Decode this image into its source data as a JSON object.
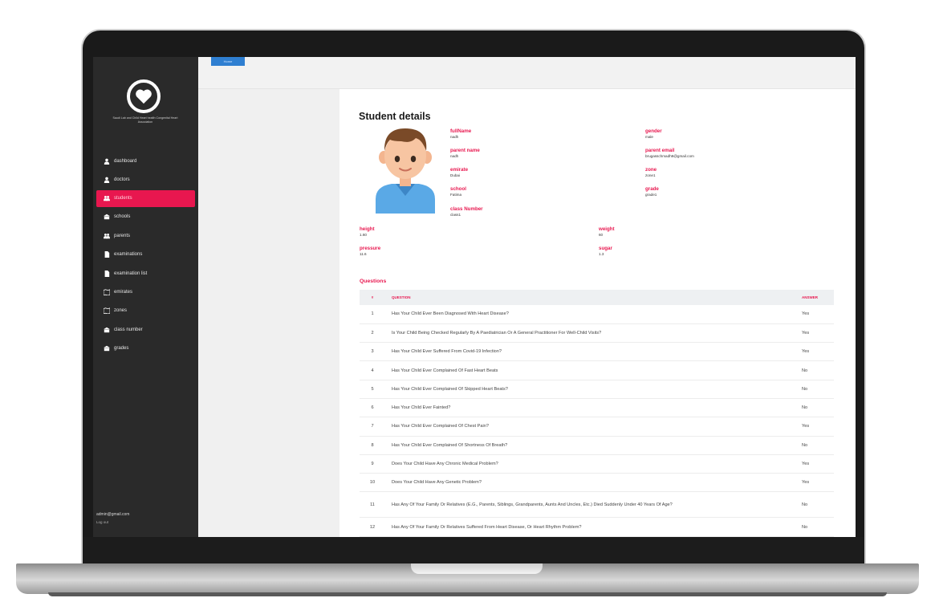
{
  "logo": {
    "icon": "heart-icon",
    "subtitle": "Saudi Lab and Child Heart health Congenital Heart Association"
  },
  "sidebar": {
    "items": [
      {
        "label": "dashboard",
        "icon": "user-icon"
      },
      {
        "label": "doctors",
        "icon": "user-icon"
      },
      {
        "label": "students",
        "icon": "users-icon"
      },
      {
        "label": "schools",
        "icon": "school-icon"
      },
      {
        "label": "parents",
        "icon": "users-icon"
      },
      {
        "label": "examinations",
        "icon": "file-icon"
      },
      {
        "label": "examination list",
        "icon": "file-icon"
      },
      {
        "label": "emirates",
        "icon": "map-icon"
      },
      {
        "label": "zones",
        "icon": "map-icon"
      },
      {
        "label": "class number",
        "icon": "school-icon"
      },
      {
        "label": "grades",
        "icon": "school-icon"
      }
    ],
    "active_index": 2,
    "user_email": "admin@gmail.com",
    "logout_label": "Log out"
  },
  "topbar": {
    "tab_label": "Home"
  },
  "student": {
    "title": "Student details",
    "fullname": {
      "label": "fullName",
      "value": "nadh"
    },
    "parent_name": {
      "label": "parent name",
      "value": "nadh"
    },
    "emirate": {
      "label": "emirate",
      "value": "Dubai"
    },
    "school": {
      "label": "school",
      "value": "Fatima"
    },
    "class_number": {
      "label": "class Number",
      "value": "class1"
    },
    "gender": {
      "label": "gender",
      "value": "male"
    },
    "parent_email": {
      "label": "parent email",
      "value": "brugasschmadh9@gmail.com"
    },
    "zone": {
      "label": "zone",
      "value": "zone1"
    },
    "grade": {
      "label": "grade",
      "value": "grade1"
    },
    "height": {
      "label": "height",
      "value": "1.60"
    },
    "weight": {
      "label": "weight",
      "value": "60"
    },
    "pressure": {
      "label": "pressure",
      "value": "11.6"
    },
    "sugar": {
      "label": "sugar",
      "value": "1.3"
    }
  },
  "questions": {
    "heading": "Questions",
    "columns": {
      "num": "#",
      "question": "QUESTION",
      "answer": "ANSWER"
    },
    "rows": [
      {
        "n": "1",
        "q": "Has Your Child Ever Been Diagnosed With Heart Disease?",
        "a": "Yes"
      },
      {
        "n": "2",
        "q": "Is Your Child Being Checked Regularly By A Paediatrician Or A General Practitioner For Well-Child Visits?",
        "a": "Yes"
      },
      {
        "n": "3",
        "q": "Has Your Child Ever Suffered From Covid-19 Infection?",
        "a": "Yes"
      },
      {
        "n": "4",
        "q": "Has Your Child Ever Complained Of Fast Heart Beats",
        "a": "No"
      },
      {
        "n": "5",
        "q": "Has Your Child Ever Complained Of Skipped Heart Beats?",
        "a": "No"
      },
      {
        "n": "6",
        "q": "Has Your Child Ever Fainted?",
        "a": "No"
      },
      {
        "n": "7",
        "q": "Has Your Child Ever Complained Of Chest Pain?",
        "a": "Yes"
      },
      {
        "n": "8",
        "q": "Has Your Child Ever Complained Of Shortness Of Breath?",
        "a": "No"
      },
      {
        "n": "9",
        "q": "Does Your Child Have Any Chronic Medical Problem?",
        "a": "Yes"
      },
      {
        "n": "10",
        "q": "Does Your Child Have Any Genetic Problem?",
        "a": "Yes"
      },
      {
        "n": "11",
        "q": "Has Any Of Your Family Or Relatives (E.G., Parents, Siblings, Grandparents, Aunts And Uncles, Etc.) Died Suddenly Under 40 Years Of Age?",
        "a": "No"
      },
      {
        "n": "12",
        "q": "Has Any Of Your Family Or Relatives Suffered From Heart Disease, Or Heart Rhythm Problem?",
        "a": "No"
      }
    ]
  },
  "colors": {
    "accent": "#e8174f",
    "sidebar": "#2a2a2a",
    "tab": "#2f7fd1"
  }
}
